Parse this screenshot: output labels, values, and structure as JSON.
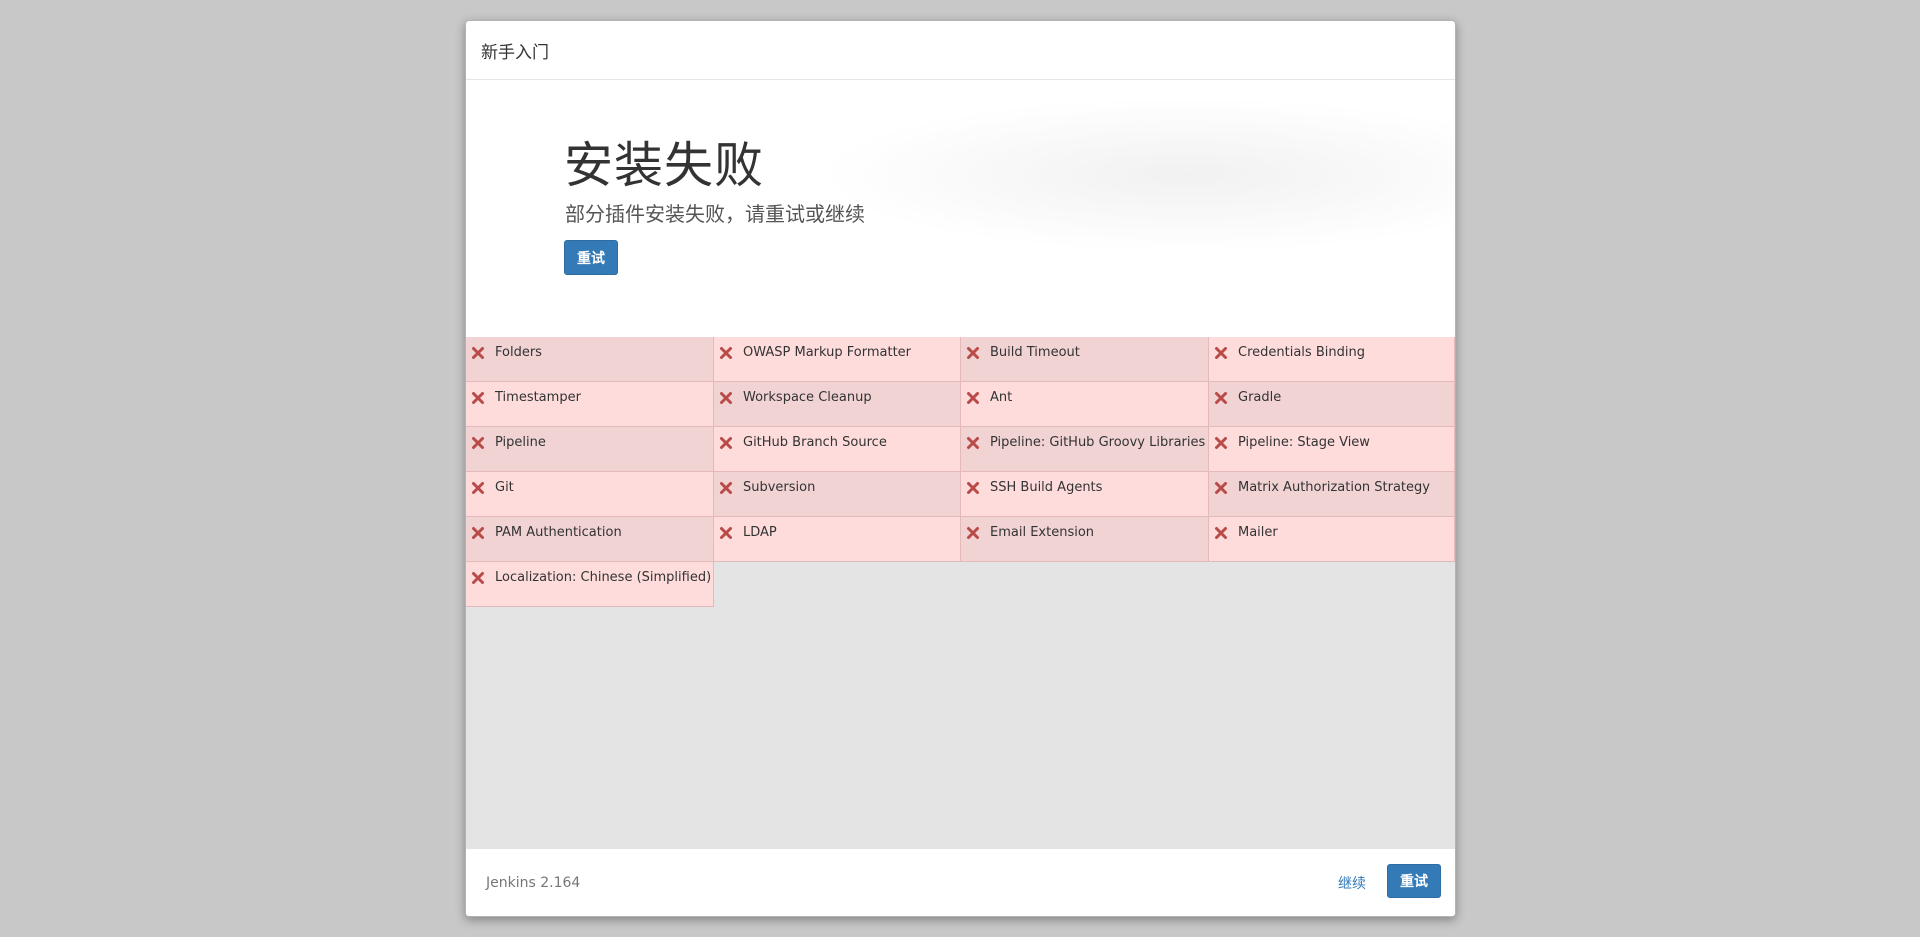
{
  "header": {
    "title": "新手入门"
  },
  "hero": {
    "title": "安装失败",
    "subtitle": "部分插件安装失败，请重试或继续",
    "retry_label": "重试"
  },
  "plugins": [
    {
      "name": "Folders",
      "status": "failed"
    },
    {
      "name": "OWASP Markup Formatter",
      "status": "failed"
    },
    {
      "name": "Build Timeout",
      "status": "failed"
    },
    {
      "name": "Credentials Binding",
      "status": "failed"
    },
    {
      "name": "Timestamper",
      "status": "failed"
    },
    {
      "name": "Workspace Cleanup",
      "status": "failed"
    },
    {
      "name": "Ant",
      "status": "failed"
    },
    {
      "name": "Gradle",
      "status": "failed"
    },
    {
      "name": "Pipeline",
      "status": "failed"
    },
    {
      "name": "GitHub Branch Source",
      "status": "failed"
    },
    {
      "name": "Pipeline: GitHub Groovy Libraries",
      "status": "failed"
    },
    {
      "name": "Pipeline: Stage View",
      "status": "failed"
    },
    {
      "name": "Git",
      "status": "failed"
    },
    {
      "name": "Subversion",
      "status": "failed"
    },
    {
      "name": "SSH Build Agents",
      "status": "failed"
    },
    {
      "name": "Matrix Authorization Strategy",
      "status": "failed"
    },
    {
      "name": "PAM Authentication",
      "status": "failed"
    },
    {
      "name": "LDAP",
      "status": "failed"
    },
    {
      "name": "Email Extension",
      "status": "failed"
    },
    {
      "name": "Mailer",
      "status": "failed"
    },
    {
      "name": "Localization: Chinese (Simplified)",
      "status": "failed"
    }
  ],
  "icons": {
    "failed": "close-icon"
  },
  "colors": {
    "primary": "#337ab7",
    "failed_bg": "#fedcdc",
    "failed_bg_alt": "#f1d3d4",
    "failed_icon": "#b94a48"
  },
  "footer": {
    "version": "Jenkins 2.164",
    "continue_label": "继续",
    "retry_label": "重试"
  }
}
